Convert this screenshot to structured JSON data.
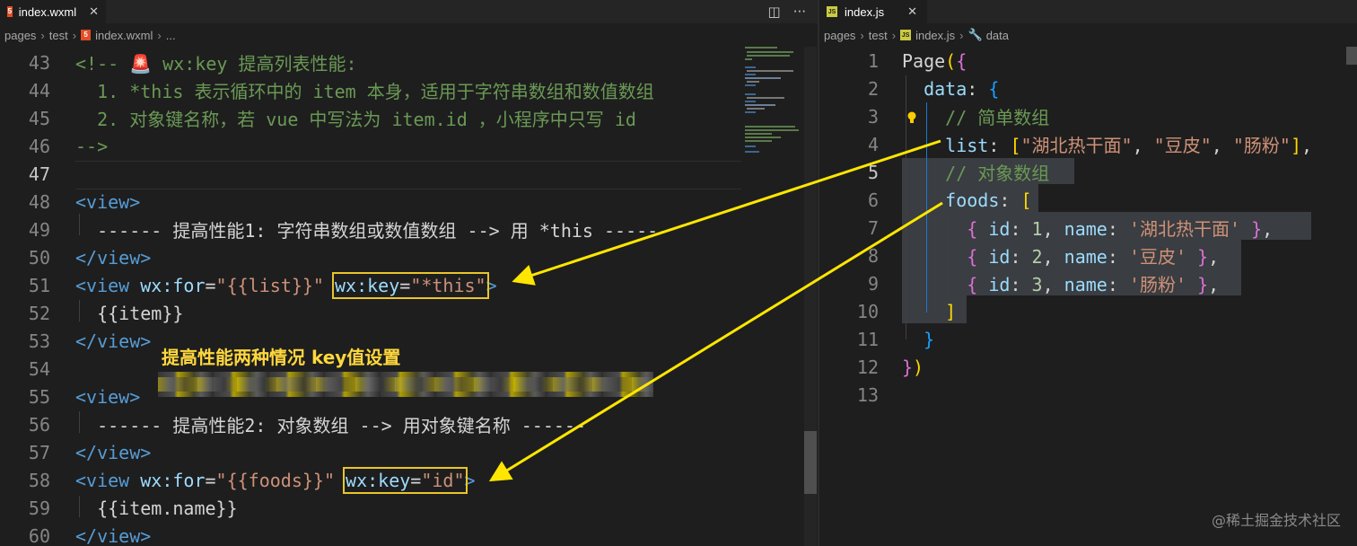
{
  "left_pane": {
    "tab": {
      "label": "index.wxml",
      "icon": "html5-icon"
    },
    "actions": {
      "split_label": "◫",
      "more_label": "···"
    },
    "breadcrumb": {
      "items": [
        "pages",
        "test",
        "index.wxml",
        "..."
      ]
    },
    "lines": [
      {
        "n": "43",
        "tokens": [
          {
            "t": "<!-- ",
            "c": "cmt"
          },
          {
            "t": "🚨",
            "c": "txt"
          },
          {
            "t": " wx:key 提高列表性能:",
            "c": "cmt"
          }
        ]
      },
      {
        "n": "44",
        "tokens": [
          {
            "t": "  1. *this 表示循环中的 item 本身，适用于字符串数组和数值数组",
            "c": "cmt"
          }
        ]
      },
      {
        "n": "45",
        "tokens": [
          {
            "t": "  2. 对象键名称，若 vue 中写法为 item.id ，小程序中只写 id",
            "c": "cmt"
          }
        ]
      },
      {
        "n": "46",
        "tokens": [
          {
            "t": "-->",
            "c": "cmt"
          }
        ]
      },
      {
        "n": "47",
        "tokens": []
      },
      {
        "n": "48",
        "tokens": [
          {
            "t": "<view>",
            "c": "tag"
          }
        ]
      },
      {
        "n": "49",
        "tokens": [
          {
            "t": "  ------ 提高性能1: 字符串数组或数值数组 --> 用 *this ------",
            "c": "txt"
          }
        ]
      },
      {
        "n": "50",
        "tokens": [
          {
            "t": "</view>",
            "c": "tag"
          }
        ]
      },
      {
        "n": "51",
        "tokens": [
          {
            "t": "<view ",
            "c": "tag"
          },
          {
            "t": "wx:for",
            "c": "attr"
          },
          {
            "t": "=",
            "c": "txt"
          },
          {
            "t": "\"{{list}}\"",
            "c": "str"
          },
          {
            "t": " ",
            "c": "txt"
          },
          {
            "t": "wx:key",
            "c": "attr",
            "box": true,
            "boxstart": true
          },
          {
            "t": "=",
            "c": "txt",
            "box": true
          },
          {
            "t": "\"*this\"",
            "c": "str",
            "box": true,
            "boxend": true
          },
          {
            "t": ">",
            "c": "tag"
          }
        ]
      },
      {
        "n": "52",
        "tokens": [
          {
            "t": "  {{item}}",
            "c": "txt"
          }
        ]
      },
      {
        "n": "53",
        "tokens": [
          {
            "t": "</view>",
            "c": "tag"
          }
        ]
      },
      {
        "n": "54",
        "tokens": []
      },
      {
        "n": "55",
        "tokens": [
          {
            "t": "<view>",
            "c": "tag"
          }
        ]
      },
      {
        "n": "56",
        "tokens": [
          {
            "t": "  ------ 提高性能2: 对象数组 --> 用对象键名称 ------",
            "c": "txt"
          }
        ]
      },
      {
        "n": "57",
        "tokens": [
          {
            "t": "</view>",
            "c": "tag"
          }
        ]
      },
      {
        "n": "58",
        "tokens": [
          {
            "t": "<view ",
            "c": "tag"
          },
          {
            "t": "wx:for",
            "c": "attr"
          },
          {
            "t": "=",
            "c": "txt"
          },
          {
            "t": "\"{{foods}}\"",
            "c": "str"
          },
          {
            "t": " ",
            "c": "txt"
          },
          {
            "t": "wx:key",
            "c": "attr",
            "box": true,
            "boxstart": true
          },
          {
            "t": "=",
            "c": "txt",
            "box": true
          },
          {
            "t": "\"id\"",
            "c": "str",
            "box": true,
            "boxend": true
          },
          {
            "t": ">",
            "c": "tag"
          }
        ]
      },
      {
        "n": "59",
        "tokens": [
          {
            "t": "  {{item.name}}",
            "c": "txt"
          }
        ]
      },
      {
        "n": "60",
        "tokens": [
          {
            "t": "</view>",
            "c": "tag"
          }
        ]
      }
    ]
  },
  "right_pane": {
    "tab": {
      "label": "index.js",
      "icon": "js-icon"
    },
    "breadcrumb": {
      "items": [
        "pages",
        "test",
        "index.js",
        "data"
      ]
    },
    "lines": [
      {
        "n": "1",
        "tokens": [
          {
            "t": "Page",
            "c": "txt"
          },
          {
            "t": "(",
            "c": "yb"
          },
          {
            "t": "{",
            "c": "pb"
          }
        ]
      },
      {
        "n": "2",
        "tokens": [
          {
            "t": "  ",
            "c": "txt"
          },
          {
            "t": "data",
            "c": "attr"
          },
          {
            "t": ": ",
            "c": "txt"
          },
          {
            "t": "{",
            "c": "bb"
          }
        ]
      },
      {
        "n": "3",
        "tokens": [
          {
            "t": "    // 简单数组",
            "c": "cmt"
          }
        ]
      },
      {
        "n": "4",
        "tokens": [
          {
            "t": "    ",
            "c": "txt"
          },
          {
            "t": "list",
            "c": "attr"
          },
          {
            "t": ": ",
            "c": "txt"
          },
          {
            "t": "[",
            "c": "yb"
          },
          {
            "t": "\"湖北热干面\"",
            "c": "str"
          },
          {
            "t": ", ",
            "c": "txt"
          },
          {
            "t": "\"豆皮\"",
            "c": "str"
          },
          {
            "t": ", ",
            "c": "txt"
          },
          {
            "t": "\"肠粉\"",
            "c": "str"
          },
          {
            "t": "]",
            "c": "yb"
          },
          {
            "t": ",",
            "c": "txt"
          }
        ]
      },
      {
        "n": "5",
        "tokens": [
          {
            "t": "    // 对象数组",
            "c": "cmt"
          }
        ]
      },
      {
        "n": "6",
        "tokens": [
          {
            "t": "    ",
            "c": "txt"
          },
          {
            "t": "foods",
            "c": "attr"
          },
          {
            "t": ": ",
            "c": "txt"
          },
          {
            "t": "[",
            "c": "yb"
          }
        ]
      },
      {
        "n": "7",
        "tokens": [
          {
            "t": "      ",
            "c": "txt"
          },
          {
            "t": "{",
            "c": "pb"
          },
          {
            "t": " ",
            "c": "txt"
          },
          {
            "t": "id",
            "c": "attr"
          },
          {
            "t": ": ",
            "c": "txt"
          },
          {
            "t": "1",
            "c": "num"
          },
          {
            "t": ", ",
            "c": "txt"
          },
          {
            "t": "name",
            "c": "attr"
          },
          {
            "t": ": ",
            "c": "txt"
          },
          {
            "t": "'湖北热干面'",
            "c": "str"
          },
          {
            "t": " ",
            "c": "txt"
          },
          {
            "t": "}",
            "c": "pb"
          },
          {
            "t": ",",
            "c": "txt"
          }
        ]
      },
      {
        "n": "8",
        "tokens": [
          {
            "t": "      ",
            "c": "txt"
          },
          {
            "t": "{",
            "c": "pb"
          },
          {
            "t": " ",
            "c": "txt"
          },
          {
            "t": "id",
            "c": "attr"
          },
          {
            "t": ": ",
            "c": "txt"
          },
          {
            "t": "2",
            "c": "num"
          },
          {
            "t": ", ",
            "c": "txt"
          },
          {
            "t": "name",
            "c": "attr"
          },
          {
            "t": ": ",
            "c": "txt"
          },
          {
            "t": "'豆皮'",
            "c": "str"
          },
          {
            "t": " ",
            "c": "txt"
          },
          {
            "t": "}",
            "c": "pb"
          },
          {
            "t": ",",
            "c": "txt"
          }
        ]
      },
      {
        "n": "9",
        "tokens": [
          {
            "t": "      ",
            "c": "txt"
          },
          {
            "t": "{",
            "c": "pb"
          },
          {
            "t": " ",
            "c": "txt"
          },
          {
            "t": "id",
            "c": "attr"
          },
          {
            "t": ": ",
            "c": "txt"
          },
          {
            "t": "3",
            "c": "num"
          },
          {
            "t": ", ",
            "c": "txt"
          },
          {
            "t": "name",
            "c": "attr"
          },
          {
            "t": ": ",
            "c": "txt"
          },
          {
            "t": "'肠粉'",
            "c": "str"
          },
          {
            "t": " ",
            "c": "txt"
          },
          {
            "t": "}",
            "c": "pb"
          },
          {
            "t": ",",
            "c": "txt"
          }
        ]
      },
      {
        "n": "10",
        "tokens": [
          {
            "t": "    ",
            "c": "txt"
          },
          {
            "t": "]",
            "c": "yb"
          }
        ]
      },
      {
        "n": "11",
        "tokens": [
          {
            "t": "  ",
            "c": "txt"
          },
          {
            "t": "}",
            "c": "bb"
          }
        ]
      },
      {
        "n": "12",
        "tokens": [
          {
            "t": "}",
            "c": "pb"
          },
          {
            "t": ")",
            "c": "yb"
          }
        ]
      },
      {
        "n": "13",
        "tokens": []
      }
    ]
  },
  "annotation": {
    "title": "提高性能两种情况 key值设置"
  },
  "watermark": "@稀土掘金技术社区",
  "colors": {
    "arrow": "#ffe600",
    "highlight_box": "#e8c62a",
    "comment": "#6a9955",
    "tag": "#569cd6",
    "attribute": "#9cdcfe",
    "string": "#ce9178"
  }
}
